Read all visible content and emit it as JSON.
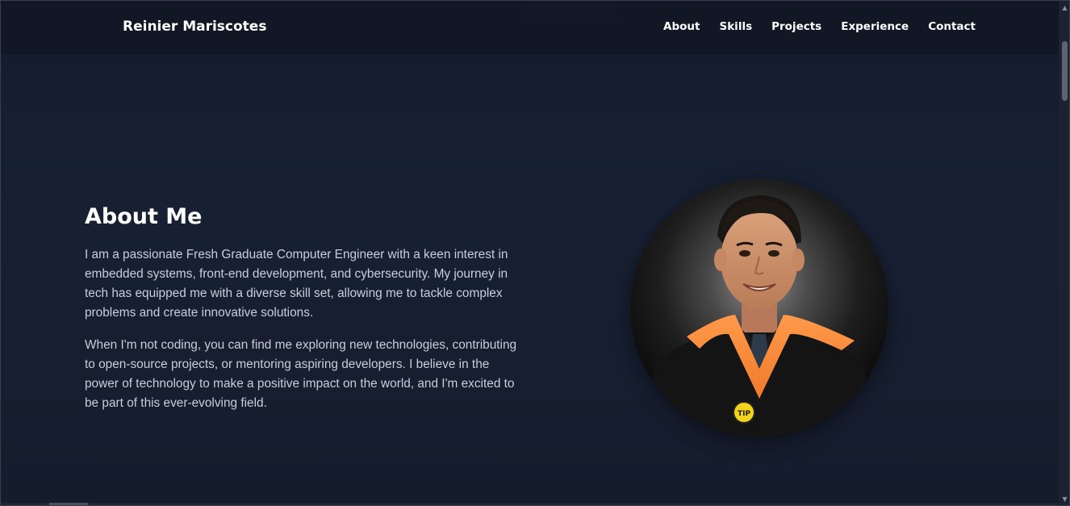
{
  "header": {
    "site_name": "Reinier Mariscotes",
    "nav": [
      {
        "label": "About"
      },
      {
        "label": "Skills"
      },
      {
        "label": "Projects"
      },
      {
        "label": "Experience"
      },
      {
        "label": "Contact"
      }
    ]
  },
  "about": {
    "title": "About Me",
    "paragraphs": [
      "I am a passionate Fresh Graduate Computer Engineer with a keen interest in embedded systems, front-end development, and cybersecurity. My journey in tech has equipped me with a diverse skill set, allowing me to tackle complex problems and create innovative solutions.",
      "When I'm not coding, you can find me exploring new technologies, contributing to open-source projects, or mentoring aspiring developers. I believe in the power of technology to make a positive impact on the world, and I'm excited to be part of this ever-evolving field."
    ],
    "portrait": {
      "badge_text": "TIP"
    }
  },
  "colors": {
    "background": "#161d2d",
    "header_bg": "#111725",
    "accent_orange": "#ff8a3d",
    "text_primary": "#ffffff",
    "text_body": "#c9ced8"
  },
  "icons": {
    "scroll_up": "chevron-up-icon",
    "scroll_down": "chevron-down-icon"
  }
}
